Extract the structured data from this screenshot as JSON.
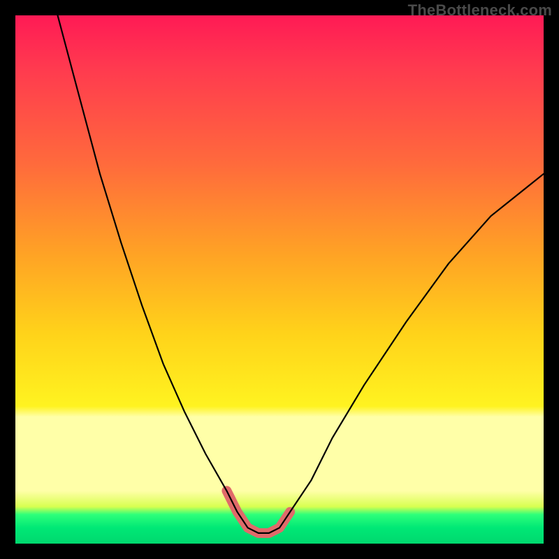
{
  "watermark": "TheBottleneck.com",
  "colors": {
    "background": "#000000",
    "watermark_text": "#4a4a4a",
    "curve": "#000000",
    "highlight": "#e06a6a",
    "gradient_top": "#ff1a55",
    "gradient_mid": "#ffd21a",
    "gradient_band": "#ffffa8",
    "gradient_bottom": "#00d86e"
  },
  "chart_data": {
    "type": "line",
    "title": "",
    "xlabel": "",
    "ylabel": "",
    "xlim": [
      0,
      100
    ],
    "ylim": [
      0,
      100
    ],
    "grid": false,
    "legend": false,
    "note": "V-shaped bottleneck curve over a red→yellow→green vertical gradient. Bottom salmon segment marks the optimal (min) region.",
    "series": [
      {
        "name": "bottleneck-curve",
        "x": [
          8,
          12,
          16,
          20,
          24,
          28,
          32,
          36,
          40,
          42,
          44,
          46,
          48,
          50,
          52,
          56,
          60,
          66,
          74,
          82,
          90,
          100
        ],
        "values": [
          100,
          85,
          70,
          57,
          45,
          34,
          25,
          17,
          10,
          6,
          3,
          2,
          2,
          3,
          6,
          12,
          20,
          30,
          42,
          53,
          62,
          70
        ]
      }
    ],
    "highlight_range": {
      "name": "optimal-zone",
      "x": [
        40,
        42,
        44,
        46,
        48,
        50,
        52
      ],
      "values": [
        10,
        6,
        3,
        2,
        2,
        3,
        6
      ]
    }
  }
}
